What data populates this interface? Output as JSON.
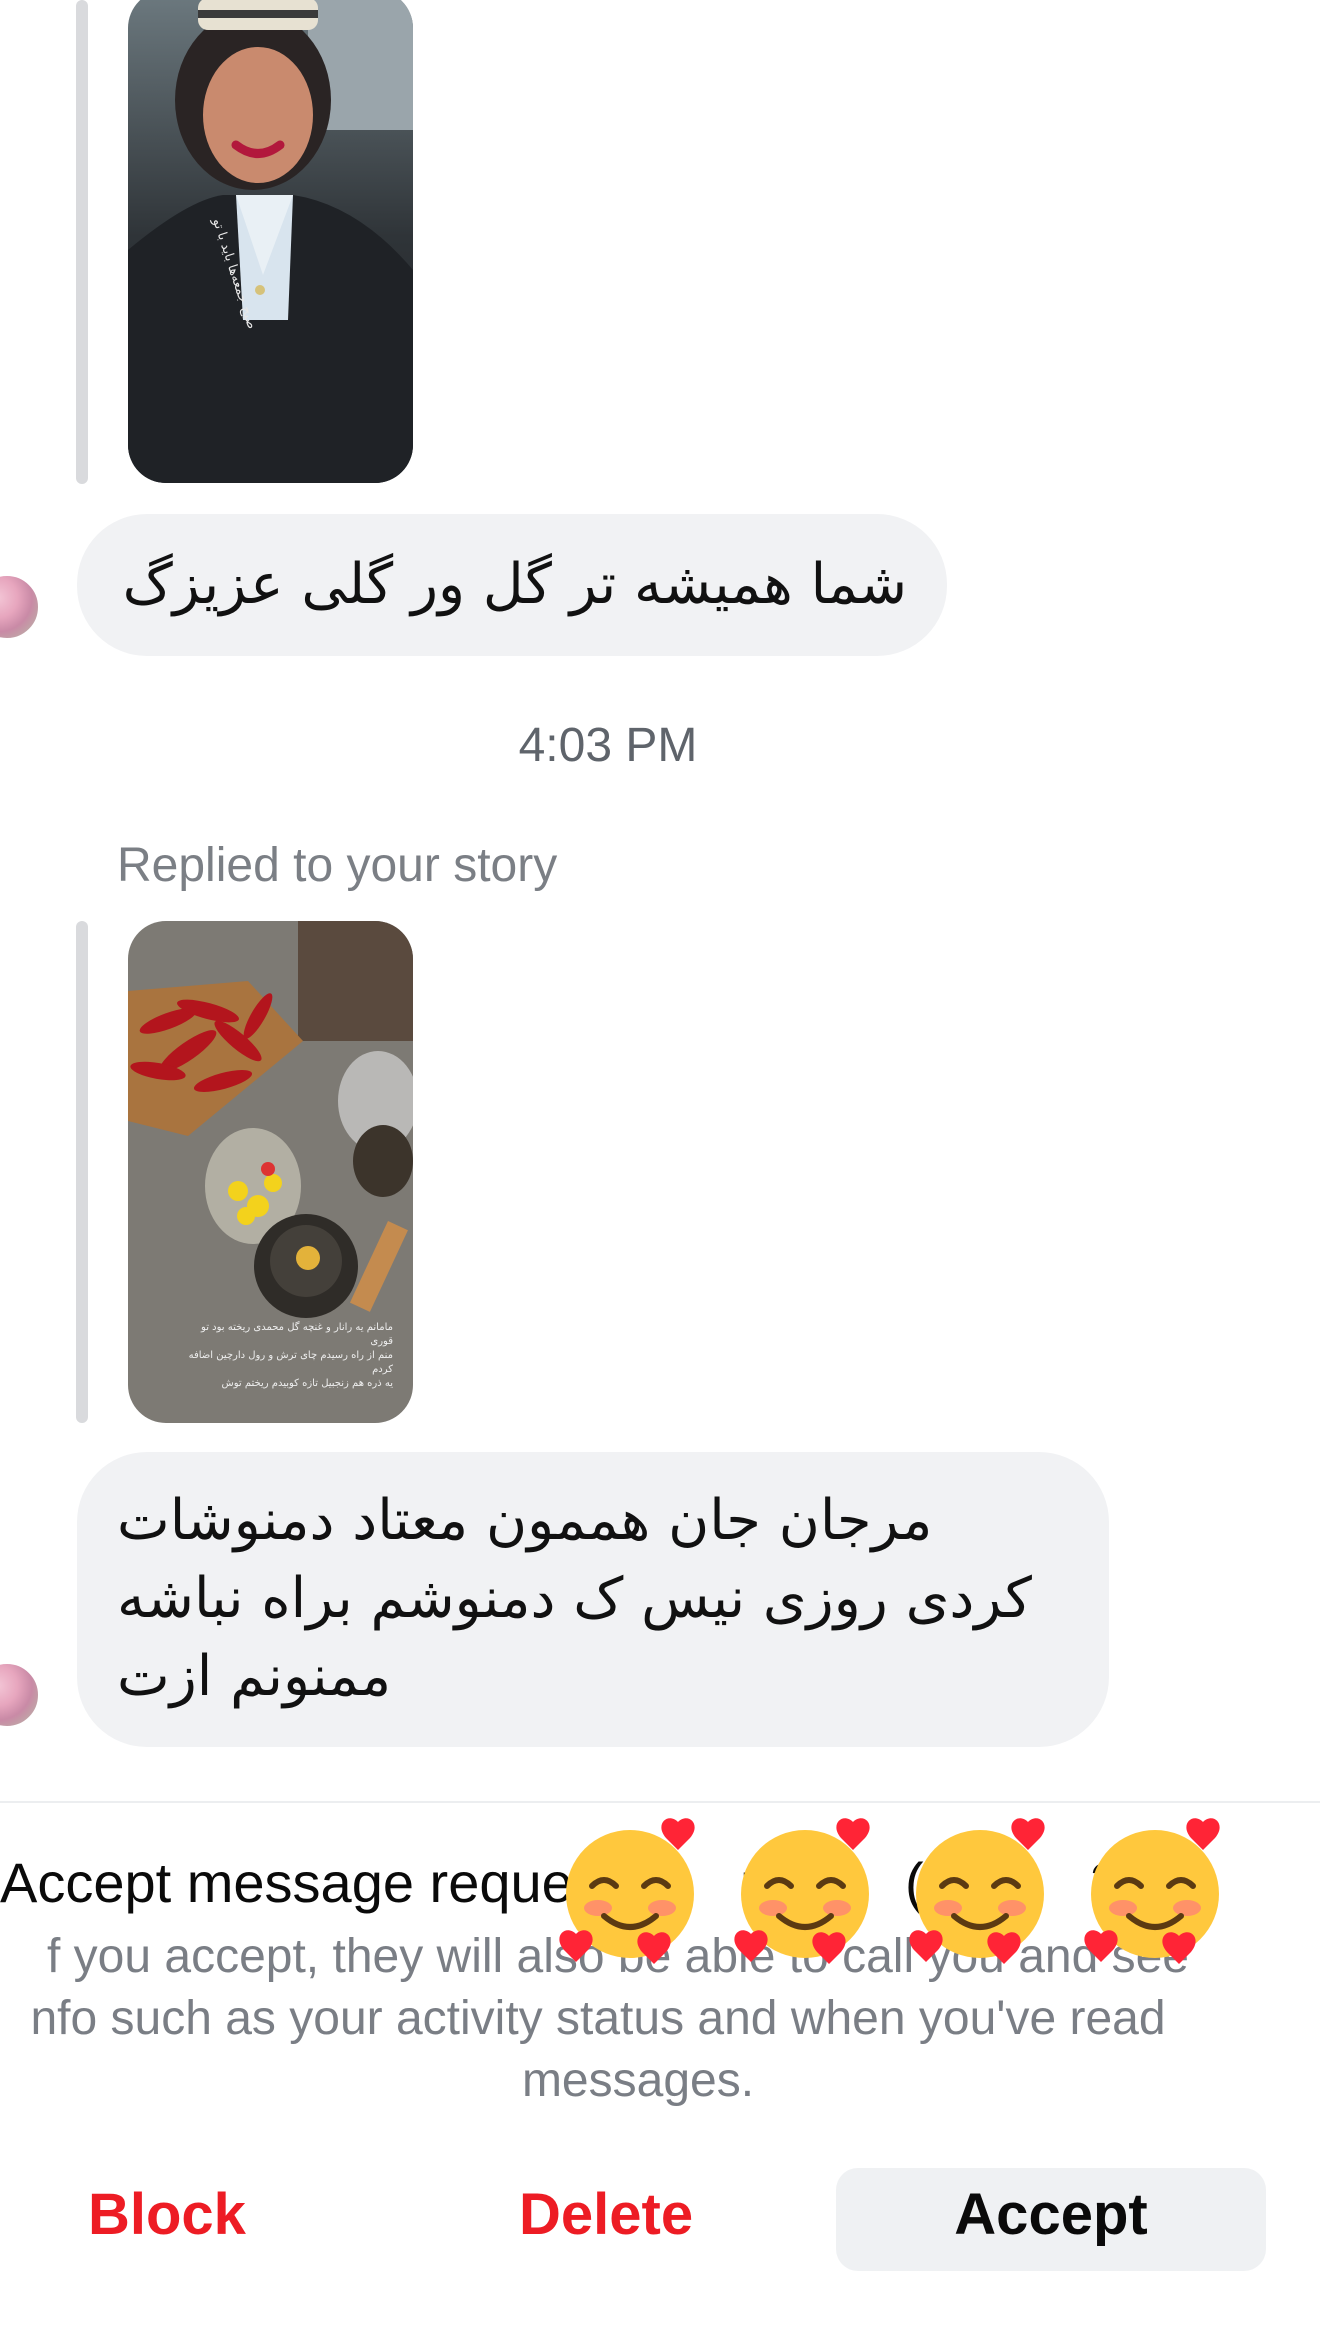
{
  "conversation": {
    "messages": [
      {
        "type": "text",
        "text": "شما همیشه تر گل ور گلی عزیزگ"
      }
    ],
    "timestamp": "4:03 PM",
    "story_reply_label": "Replied to your story",
    "second_message_lines": [
      "مرجان جان هممون معتاد دمنوشات",
      "کردی روزی نیس ک دمنوشم براه نباشه",
      "ممنونم ازت"
    ]
  },
  "story_caption_lines": [
    "مامانم یه رانار و غنچه گل محمدی ریخته بود تو",
    "قوری",
    "منم از راه رسیدم چای ترش و رول دارچین اضافه",
    "کردم",
    "یه ذره هم زنجبیل تازه کوبیدم ریختم توش"
  ],
  "request_sheet": {
    "title": "Accept message reque",
    "title_suffix": "r",
    "title_bracket": "(",
    "title_tail": "3",
    "body": "f you accept, they will also be able to call you and see info such as your activity status and when you've read messages.",
    "body_line1": "f you accept, they will also be able to call you and see",
    "body_line2": "nfo such as your activity status and when you've read",
    "body_line3": "messages.",
    "block_label": "Block",
    "delete_label": "Delete",
    "accept_label": "Accept",
    "danger_color": "#ed1c24"
  },
  "overlay_emoji": {
    "icon": "smiling-face-with-hearts-icon",
    "count": 4
  }
}
